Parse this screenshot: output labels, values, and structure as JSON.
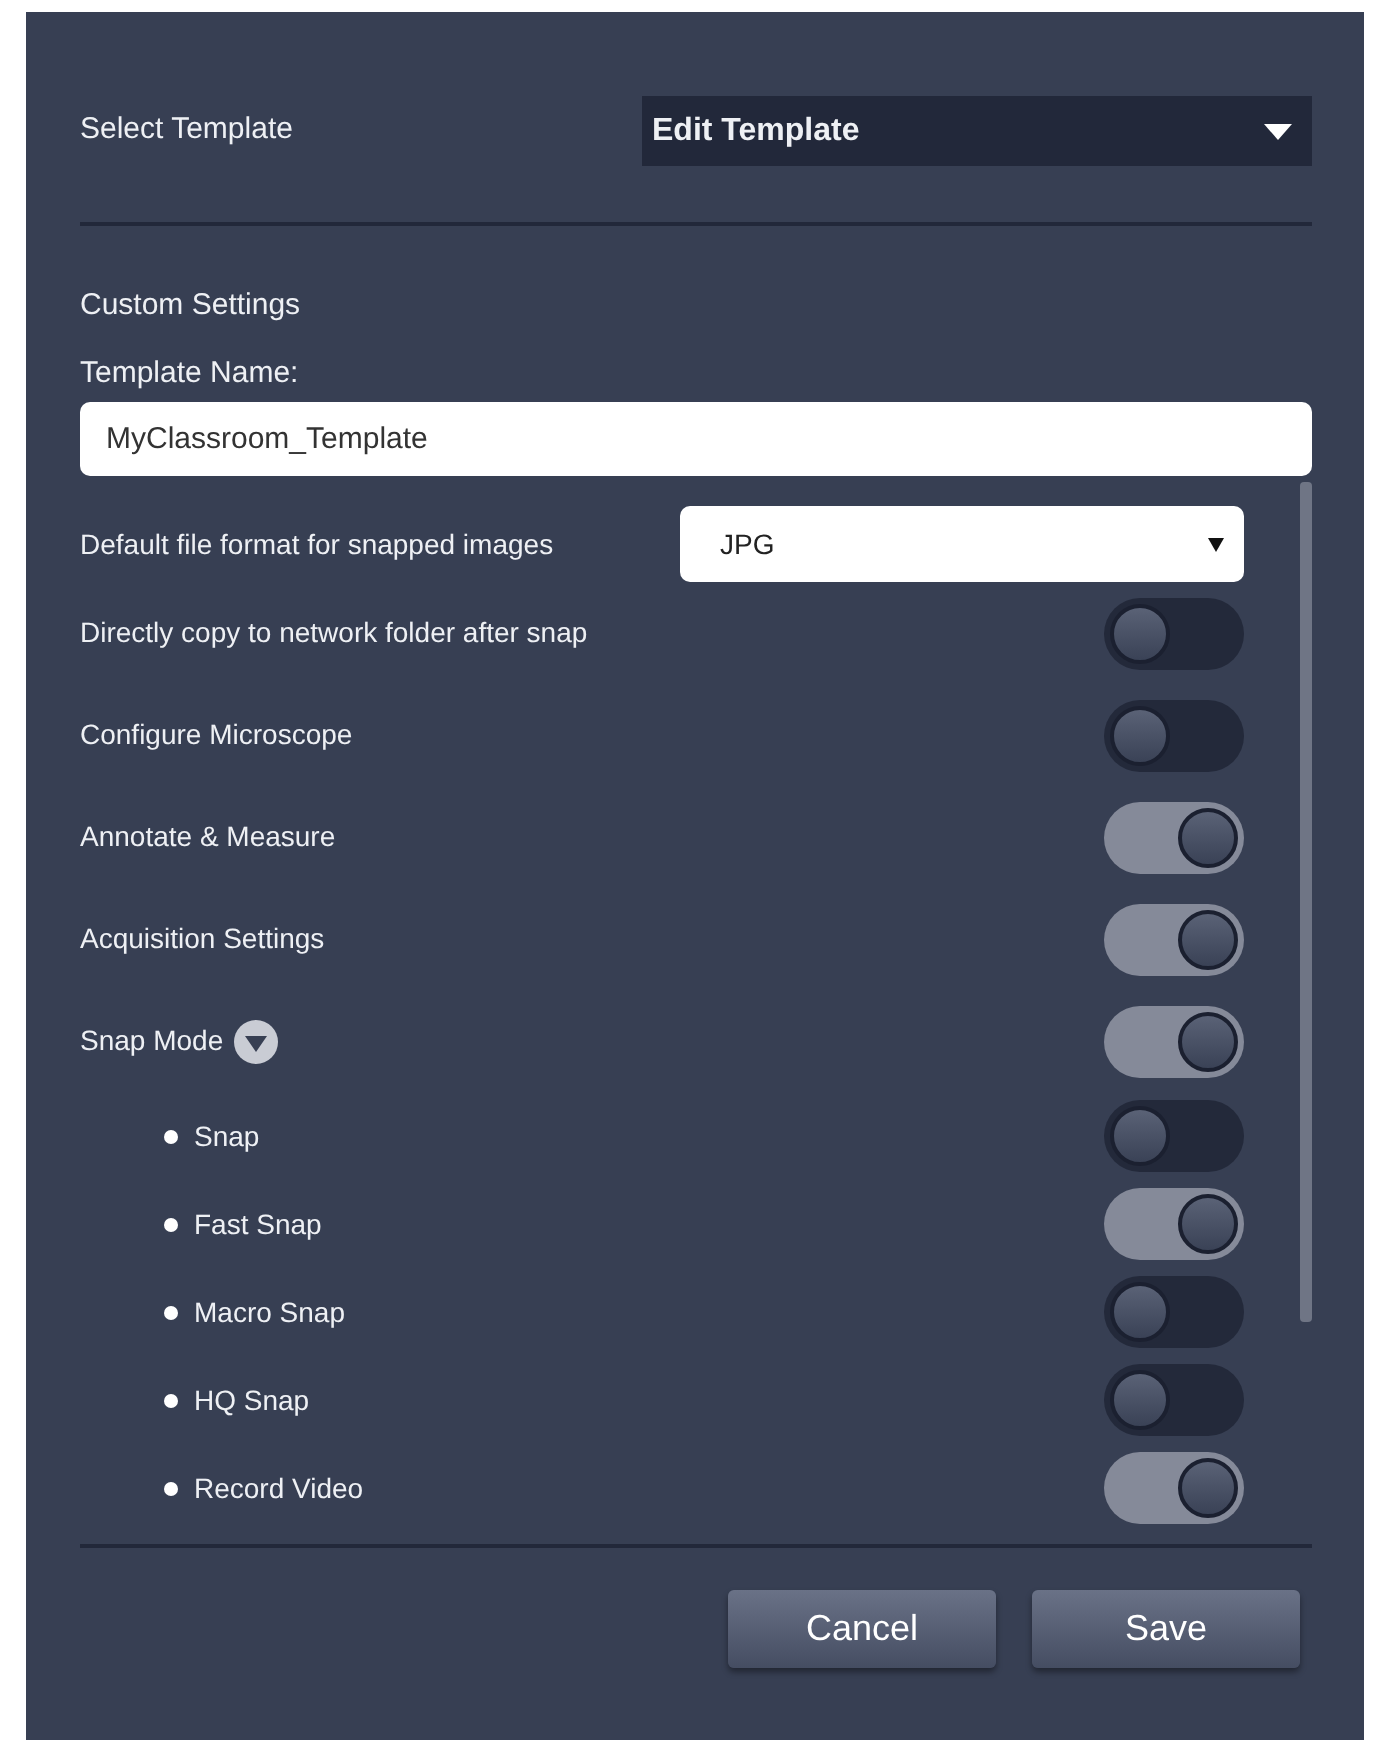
{
  "template_select": {
    "label": "Select Template",
    "value": "Edit Template"
  },
  "section_title": "Custom Settings",
  "template_name": {
    "label": "Template Name:",
    "value": "MyClassroom_Template"
  },
  "file_format": {
    "label": "Default file format for snapped images",
    "value": "JPG"
  },
  "settings": [
    {
      "label": "Directly copy to network folder after snap",
      "on": false
    },
    {
      "label": "Configure Microscope",
      "on": false
    },
    {
      "label": "Annotate & Measure",
      "on": true
    },
    {
      "label": "Acquisition Settings",
      "on": true
    },
    {
      "label": "Snap Mode",
      "on": true,
      "expanded": true,
      "children": [
        {
          "label": "Snap",
          "on": false
        },
        {
          "label": "Fast Snap",
          "on": true
        },
        {
          "label": "Macro Snap",
          "on": false
        },
        {
          "label": "HQ Snap",
          "on": false
        },
        {
          "label": "Record Video",
          "on": true
        }
      ]
    }
  ],
  "buttons": [
    "Cancel",
    "Save"
  ]
}
